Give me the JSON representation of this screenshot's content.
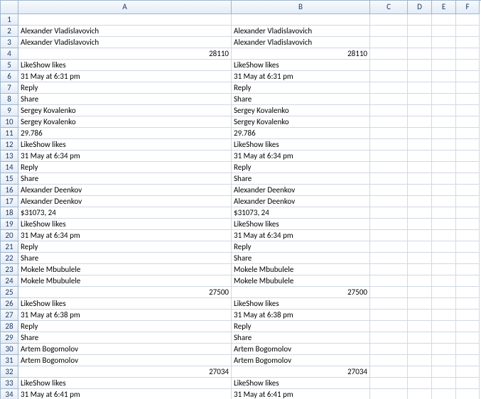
{
  "columns": [
    "A",
    "B",
    "C",
    "D",
    "E",
    "F"
  ],
  "rowCount": 34,
  "cells": {
    "r2": {
      "A": "Alexander Vladislavovich",
      "B": "Alexander Vladislavovich"
    },
    "r3": {
      "A": "Alexander Vladislavovich",
      "B": "Alexander Vladislavovich"
    },
    "r4": {
      "A": "28110",
      "A_num": true,
      "B": "28110",
      "B_num": true
    },
    "r5": {
      "A": "LikeShow likes",
      "B": "LikeShow likes"
    },
    "r6": {
      "A": "31 May at 6:31 pm",
      "B": "31 May at 6:31 pm"
    },
    "r7": {
      "A": "Reply",
      "B": "Reply"
    },
    "r8": {
      "A": "Share",
      "B": "Share"
    },
    "r9": {
      "A": "Sergey Kovalenko",
      "B": "Sergey Kovalenko"
    },
    "r10": {
      "A": "Sergey Kovalenko",
      "B": "Sergey Kovalenko"
    },
    "r11": {
      "A": "29.786",
      "B": "29.786"
    },
    "r12": {
      "A": "LikeShow likes",
      "B": "LikeShow likes"
    },
    "r13": {
      "A": "31 May at 6:34 pm",
      "B": "31 May at 6:34 pm"
    },
    "r14": {
      "A": "Reply",
      "B": "Reply"
    },
    "r15": {
      "A": "Share",
      "B": "Share"
    },
    "r16": {
      "A": "Alexander Deenkov",
      "B": "Alexander Deenkov"
    },
    "r17": {
      "A": "Alexander Deenkov",
      "B": "Alexander Deenkov"
    },
    "r18": {
      "A": "$31073, 24",
      "B": "$31073, 24"
    },
    "r19": {
      "A": "LikeShow likes",
      "B": "LikeShow likes"
    },
    "r20": {
      "A": "31 May at 6:34 pm",
      "B": "31 May at 6:34 pm"
    },
    "r21": {
      "A": "Reply",
      "B": "Reply"
    },
    "r22": {
      "A": "Share",
      "B": "Share"
    },
    "r23": {
      "A": "Mokele Mbubulele",
      "B": "Mokele Mbubulele"
    },
    "r24": {
      "A": "Mokele Mbubulele",
      "B": "Mokele Mbubulele"
    },
    "r25": {
      "A": "27500",
      "A_num": true,
      "B": "27500",
      "B_num": true
    },
    "r26": {
      "A": "LikeShow likes",
      "B": "LikeShow likes"
    },
    "r27": {
      "A": "31 May at 6:38 pm",
      "B": "31 May at 6:38 pm"
    },
    "r28": {
      "A": "Reply",
      "B": "Reply"
    },
    "r29": {
      "A": "Share",
      "B": "Share"
    },
    "r30": {
      "A": "Artem Bogomolov",
      "B": "Artem Bogomolov"
    },
    "r31": {
      "A": "Artem Bogomolov",
      "B": "Artem Bogomolov"
    },
    "r32": {
      "A": "27034",
      "A_num": true,
      "B": "27034",
      "B_num": true
    },
    "r33": {
      "A": "LikeShow likes",
      "B": "LikeShow likes"
    },
    "r34": {
      "A": "31 May at 6:41 pm",
      "B": "31 May at 6:41 pm"
    }
  }
}
